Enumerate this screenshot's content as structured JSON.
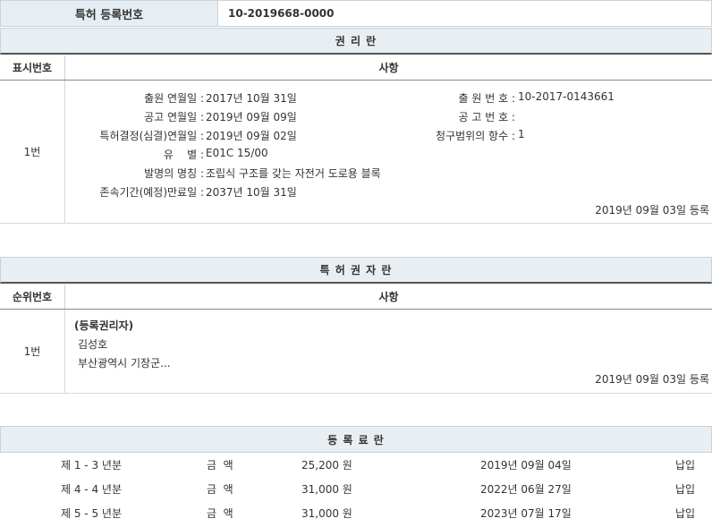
{
  "registration": {
    "label": "특허 등록번호",
    "number": "10-2019668-0000"
  },
  "rights": {
    "title": "권 리 란",
    "col_no": "표시번호",
    "col_item": "사항",
    "entry_no": "1번",
    "fields_left": [
      {
        "label": "출원 연월일 :",
        "value": "2017년 10월 31일"
      },
      {
        "label": "공고 연월일 :",
        "value": "2019년 09월 09일"
      },
      {
        "label": "특허결정(심결)연월일 :",
        "value": "2019년 09월 02일"
      },
      {
        "label": "유    별 :",
        "value": "E01C 15/00"
      },
      {
        "label": "발명의 명칭 :",
        "value": "조립식 구조를 갖는 자전거 도로용 블록"
      },
      {
        "label": "존속기간(예정)만료일 :",
        "value": "2037년 10월 31일"
      }
    ],
    "fields_right": [
      {
        "label": "출 원 번 호 :",
        "value": "10-2017-0143661"
      },
      {
        "label": "공 고 번 호 :",
        "value": ""
      },
      {
        "label": "청구범위의 항수 :",
        "value": "1"
      }
    ],
    "reg_date": "2019년 09월 03일 등록"
  },
  "holders": {
    "title": "특 허 권 자 란",
    "col_no": "순위번호",
    "col_item": "사항",
    "entry_no": "1번",
    "type": "(등록권리자)",
    "name": "김성호",
    "address": "부산광역시 기장군...",
    "reg_date": "2019년 09월 03일 등록"
  },
  "fees": {
    "title": "등 록 료 란",
    "amount_label": "금  액",
    "rows": [
      {
        "period": "제 1 - 3 년분",
        "amount": "25,200 원",
        "date": "2019년 09월 04일",
        "status": "납입"
      },
      {
        "period": "제 4 - 4 년분",
        "amount": "31,000 원",
        "date": "2022년 06월 27일",
        "status": "납입"
      },
      {
        "period": "제 5 - 5 년분",
        "amount": "31,000 원",
        "date": "2023년 07월 17일",
        "status": "납입"
      }
    ]
  }
}
